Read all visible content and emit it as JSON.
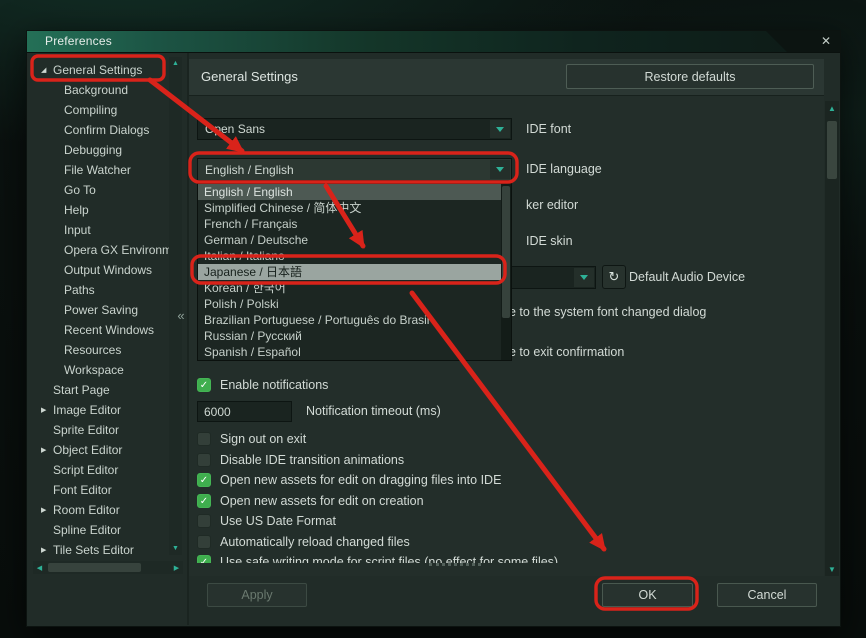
{
  "window": {
    "title": "Preferences"
  },
  "icons": {
    "close": "✕",
    "collapse": "«",
    "refresh": "↻"
  },
  "sidebar": {
    "items": [
      {
        "label": "General Settings",
        "arrow": "expanded",
        "level": 0,
        "annotated": true
      },
      {
        "label": "Background",
        "level": 1
      },
      {
        "label": "Compiling",
        "level": 1
      },
      {
        "label": "Confirm Dialogs",
        "level": 1
      },
      {
        "label": "Debugging",
        "level": 1
      },
      {
        "label": "File Watcher",
        "level": 1
      },
      {
        "label": "Go To",
        "level": 1
      },
      {
        "label": "Help",
        "level": 1
      },
      {
        "label": "Input",
        "level": 1
      },
      {
        "label": "Opera GX Environment",
        "level": 1
      },
      {
        "label": "Output Windows",
        "level": 1
      },
      {
        "label": "Paths",
        "level": 1
      },
      {
        "label": "Power Saving",
        "level": 1
      },
      {
        "label": "Recent Windows",
        "level": 1
      },
      {
        "label": "Resources",
        "level": 1
      },
      {
        "label": "Workspace",
        "level": 1
      },
      {
        "label": "Start Page",
        "level": 0
      },
      {
        "label": "Image Editor",
        "arrow": "collapsed",
        "level": 0
      },
      {
        "label": "Sprite Editor",
        "level": 0
      },
      {
        "label": "Object Editor",
        "arrow": "collapsed",
        "level": 0
      },
      {
        "label": "Script Editor",
        "level": 0
      },
      {
        "label": "Font Editor",
        "level": 0
      },
      {
        "label": "Room Editor",
        "arrow": "collapsed",
        "level": 0
      },
      {
        "label": "Spline Editor",
        "level": 0
      },
      {
        "label": "Tile Sets Editor",
        "arrow": "collapsed",
        "level": 0
      }
    ]
  },
  "header": {
    "title": "General Settings",
    "restore_defaults": "Restore defaults"
  },
  "fields": {
    "ide_font": {
      "value": "Open Sans",
      "label": "IDE font"
    },
    "ide_language": {
      "value": "English / English",
      "label": "IDE language"
    },
    "audio_device": {
      "label": "Default Audio Device"
    },
    "notification_timeout": {
      "value": "6000",
      "label": "Notification timeout (ms)"
    }
  },
  "partial_labels": {
    "editor": "ker editor",
    "ide_skin": "IDE skin",
    "font_changed_dialog": "e to the system font changed dialog",
    "exit_confirmation": "e to exit confirmation"
  },
  "language_dropdown": {
    "selected": "English / English",
    "highlighted": "Japanese / 日本語",
    "options": [
      "English / English",
      "Simplified Chinese / 简体中文",
      "French / Français",
      "German / Deutsche",
      "Italian / Italiano",
      "Japanese / 日本語",
      "Korean / 한국어",
      "Polish / Polski",
      "Brazilian Portuguese / Português do Brasil",
      "Russian / Русский",
      "Spanish / Español"
    ]
  },
  "checkboxes": [
    {
      "label": "Enable notifications",
      "checked": true
    },
    {
      "label": "Sign out on exit",
      "checked": false
    },
    {
      "label": "Disable IDE transition animations",
      "checked": false
    },
    {
      "label": "Open new assets for edit on dragging files into IDE",
      "checked": true
    },
    {
      "label": "Open new assets for edit on creation",
      "checked": true
    },
    {
      "label": "Use US Date Format",
      "checked": false
    },
    {
      "label": "Automatically reload changed files",
      "checked": false
    },
    {
      "label": "Use safe writing mode for script files (no effect for some files)",
      "checked": true
    }
  ],
  "footer": {
    "apply": "Apply",
    "ok": "OK",
    "cancel": "Cancel"
  },
  "colors": {
    "annotation_red": "#d9231a",
    "accent_teal": "#2eb197",
    "check_green": "#3fae4e"
  }
}
